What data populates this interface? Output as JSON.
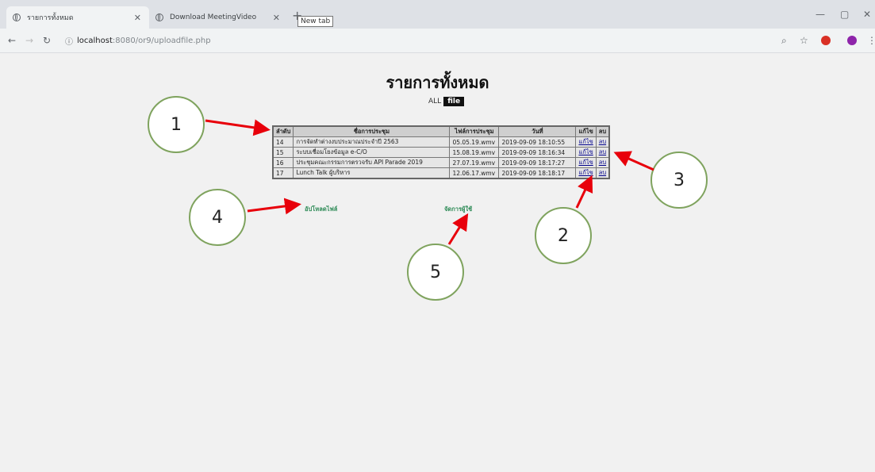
{
  "browser": {
    "tabs": [
      {
        "title": "รายการทั้งหมด",
        "active": true
      },
      {
        "title": "Download MeetingVideo",
        "active": false
      }
    ],
    "new_tab_tooltip": "New tab",
    "address": {
      "host": "localhost",
      "path": ":8080/or9/uploadfile.php"
    }
  },
  "page": {
    "title": "รายการทั้งหมด",
    "filter": {
      "all_label": "ALL",
      "file_label": "file"
    },
    "table": {
      "headers": [
        "ลำดับ",
        "ชื่อการประชุม",
        "ไฟล์การประชุม",
        "วันที่",
        "แก้ไข",
        "ลบ"
      ],
      "rows": [
        {
          "id": "14",
          "name": "การจัดทำต่างงบประมาณประจำปี 2563",
          "file": "05.05.19.wmv",
          "date": "2019-09-09 18:10:55",
          "edit": "แก้ไข",
          "delete": "ลบ"
        },
        {
          "id": "15",
          "name": "ระบบเชื่อมโยงข้อมูล e-C/O",
          "file": "15.08.19.wmv",
          "date": "2019-09-09 18:16:34",
          "edit": "แก้ไข",
          "delete": "ลบ"
        },
        {
          "id": "16",
          "name": "ประชุมคณะกรรมการตรวจรับ API Parade 2019",
          "file": "27.07.19.wmv",
          "date": "2019-09-09 18:17:27",
          "edit": "แก้ไข",
          "delete": "ลบ"
        },
        {
          "id": "17",
          "name": "Lunch Talk ผู้บริหาร",
          "file": "12.06.17.wmv",
          "date": "2019-09-09 18:18:17",
          "edit": "แก้ไข",
          "delete": "ลบ"
        }
      ]
    },
    "upload_link": "อัปโหลดไฟล์",
    "manage_users_link": "จัดการผู้ใช้"
  },
  "annotations": [
    "1",
    "2",
    "3",
    "4",
    "5"
  ],
  "colors": {
    "arrow": "#e8000b",
    "circle_border": "#7fa35e",
    "link": "#2e8b57"
  }
}
